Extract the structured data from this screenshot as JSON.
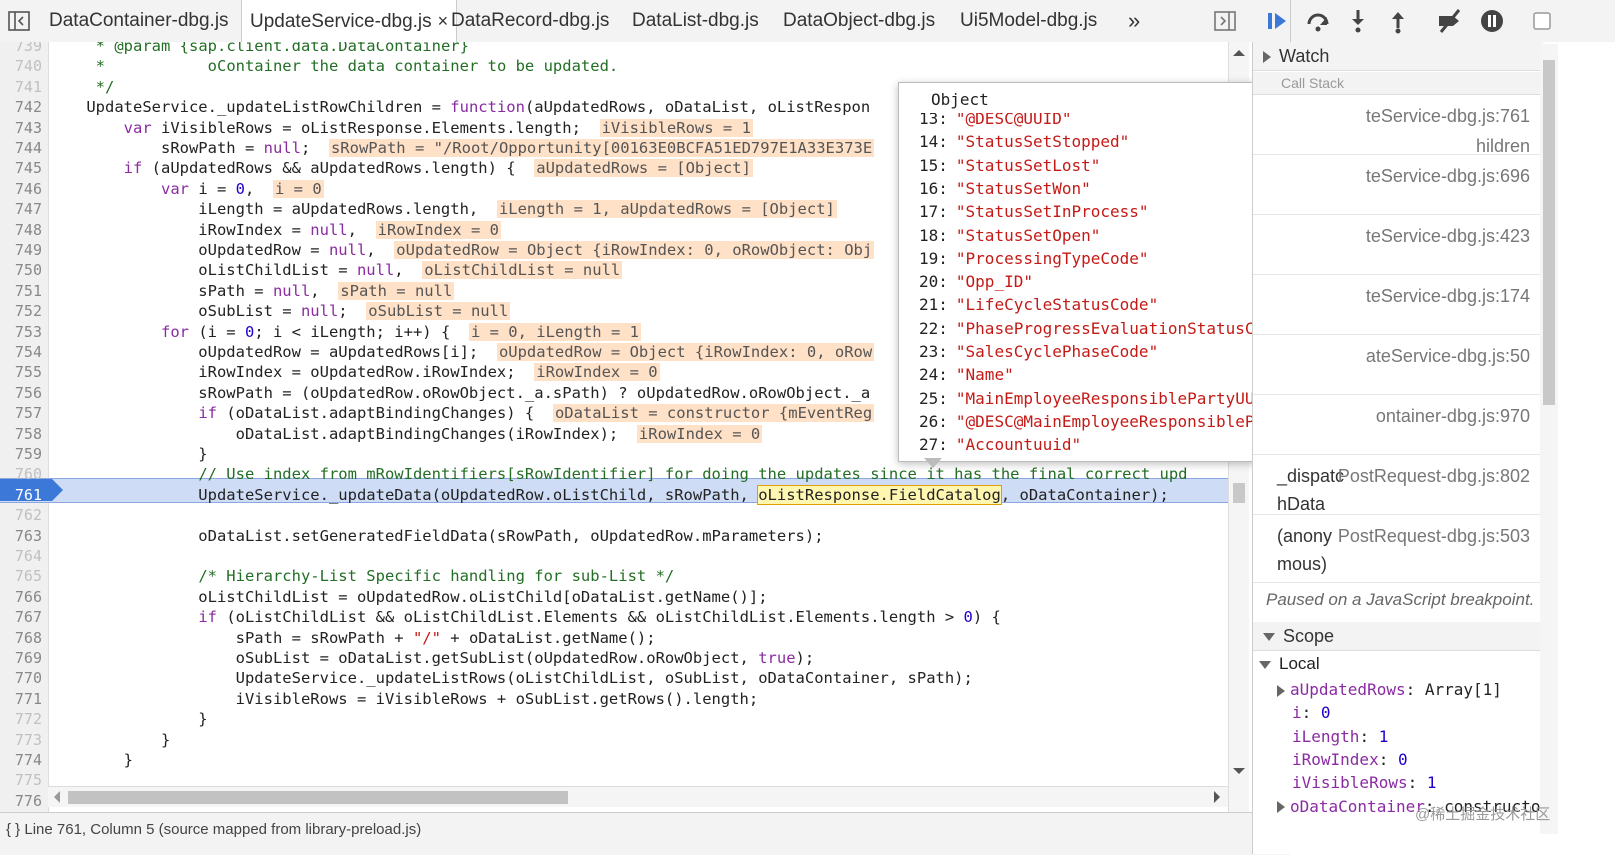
{
  "tabs": [
    {
      "label": "DataContainer-dbg.js",
      "active": false
    },
    {
      "label": "UpdateService-dbg.js",
      "active": true
    },
    {
      "label": "DataRecord-dbg.js",
      "active": false
    },
    {
      "label": "DataList-dbg.js",
      "active": false
    },
    {
      "label": "DataObject-dbg.js",
      "active": false
    },
    {
      "label": "Ui5Model-dbg.js",
      "active": false
    }
  ],
  "tabs_more": "»",
  "close_glyph": "×",
  "lines": [
    {
      "n": "739",
      "dim": true,
      "html": "     <span class=\"cm\">* @param {sap.client.data.DataContainer}</span>"
    },
    {
      "n": "740",
      "dim": true,
      "html": "     <span class=\"cm\">*           oContainer the data container to be updated.</span>"
    },
    {
      "n": "741",
      "dim": true,
      "html": "     <span class=\"cm\">*/</span>"
    },
    {
      "n": "742",
      "dim": false,
      "html": "    UpdateService._updateListRowChildren = <span class=\"fn\">function</span>(aUpdatedRows, oDataList, oListRespon"
    },
    {
      "n": "743",
      "dim": false,
      "html": "        <span class=\"kw\">var</span> iVisibleRows = oListResponse.Elements.length;  <span class=\"inl\">iVisibleRows = 1</span>"
    },
    {
      "n": "744",
      "dim": false,
      "html": "            sRowPath = <span class=\"kw\">null</span>;  <span class=\"inl\">sRowPath = \"/Root/Opportunity[00163E0BCFA51ED797E1A33E373E</span>"
    },
    {
      "n": "745",
      "dim": false,
      "html": "        <span class=\"kw\">if</span> (aUpdatedRows &amp;&amp; aUpdatedRows.length) {  <span class=\"inl\">aUpdatedRows = [Object]</span>"
    },
    {
      "n": "746",
      "dim": false,
      "html": "            <span class=\"kw\">var</span> i = <span class=\"num\">0</span>,  <span class=\"inl\">i = 0</span>"
    },
    {
      "n": "747",
      "dim": false,
      "html": "                iLength = aUpdatedRows.length,  <span class=\"inl\">iLength = 1, aUpdatedRows = [Object]</span>"
    },
    {
      "n": "748",
      "dim": false,
      "html": "                iRowIndex = <span class=\"kw\">null</span>,  <span class=\"inl\">iRowIndex = 0</span>"
    },
    {
      "n": "749",
      "dim": false,
      "html": "                oUpdatedRow = <span class=\"kw\">null</span>,  <span class=\"inl\">oUpdatedRow = Object {iRowIndex: 0, oRowObject: Obj</span>"
    },
    {
      "n": "750",
      "dim": false,
      "html": "                oListChildList = <span class=\"kw\">null</span>,  <span class=\"inl\">oListChildList = null</span>"
    },
    {
      "n": "751",
      "dim": false,
      "html": "                sPath = <span class=\"kw\">null</span>,  <span class=\"inl\">sPath = null</span>"
    },
    {
      "n": "752",
      "dim": false,
      "html": "                oSubList = <span class=\"kw\">null</span>;  <span class=\"inl\">oSubList = null</span>"
    },
    {
      "n": "753",
      "dim": false,
      "html": "            <span class=\"kw\">for</span> (i = <span class=\"num\">0</span>; i &lt; iLength; i++) {  <span class=\"inl\">i = 0, iLength = 1</span>"
    },
    {
      "n": "754",
      "dim": false,
      "html": "                oUpdatedRow = aUpdatedRows[i];  <span class=\"inl\">oUpdatedRow = Object {iRowIndex: 0, oRow</span>"
    },
    {
      "n": "755",
      "dim": false,
      "html": "                iRowIndex = oUpdatedRow.iRowIndex;  <span class=\"inl\">iRowIndex = 0</span>"
    },
    {
      "n": "756",
      "dim": false,
      "html": "                sRowPath = (oUpdatedRow.oRowObject._a.sPath) ? oUpdatedRow.oRowObject._a"
    },
    {
      "n": "757",
      "dim": false,
      "html": "                <span class=\"kw\">if</span> (oDataList.adaptBindingChanges) {  <span class=\"inl\">oDataList = constructor {mEventReg</span>"
    },
    {
      "n": "758",
      "dim": false,
      "html": "                    oDataList.adaptBindingChanges(iRowIndex);  <span class=\"inl\">iRowIndex = 0</span>"
    },
    {
      "n": "759",
      "dim": false,
      "html": "                }"
    },
    {
      "n": "760",
      "dim": true,
      "html": "                <span class=\"cm\">// Use index from mRowIdentifiers[sRowIdentifier] for doing the updates since it has the final correct upd</span>"
    },
    {
      "n": "761",
      "dim": false,
      "html": "                UpdateService._updateData(oUpdatedRow.oListChild, sRowPath, <span class=\"hovbox\">oListResponse.FieldCatalog</span>, oDataContainer);"
    },
    {
      "n": "762",
      "dim": true,
      "html": ""
    },
    {
      "n": "763",
      "dim": false,
      "html": "                oDataList.setGeneratedFieldData(sRowPath, oUpdatedRow.mParameters);"
    },
    {
      "n": "764",
      "dim": true,
      "html": ""
    },
    {
      "n": "765",
      "dim": true,
      "html": "                <span class=\"cm\">/* Hierarchy-List Specific handling for sub-List */</span>"
    },
    {
      "n": "766",
      "dim": false,
      "html": "                oListChildList = oUpdatedRow.oListChild[oDataList.getName()];"
    },
    {
      "n": "767",
      "dim": false,
      "html": "                <span class=\"kw\">if</span> (oListChildList &amp;&amp; oListChildList.Elements &amp;&amp; oListChildList.Elements.length &gt; <span class=\"num\">0</span>) {"
    },
    {
      "n": "768",
      "dim": false,
      "html": "                    sPath = sRowPath + <span class=\"str\">\"/\"</span> + oDataList.getName();"
    },
    {
      "n": "769",
      "dim": false,
      "html": "                    oSubList = oDataList.getSubList(oUpdatedRow.oRowObject, <span class=\"kw\">true</span>);"
    },
    {
      "n": "770",
      "dim": false,
      "html": "                    UpdateService._updateListRows(oListChildList, oSubList, oDataContainer, sPath);"
    },
    {
      "n": "771",
      "dim": false,
      "html": "                    iVisibleRows = iVisibleRows + oSubList.getRows().length;"
    },
    {
      "n": "772",
      "dim": true,
      "html": "                }"
    },
    {
      "n": "773",
      "dim": true,
      "html": "            }"
    },
    {
      "n": "774",
      "dim": false,
      "html": "        }"
    },
    {
      "n": "775",
      "dim": true,
      "html": ""
    },
    {
      "n": "776",
      "dim": false,
      "html": ""
    }
  ],
  "breakpoint_line": "761",
  "status_text": "{ }   Line 761, Column 5   (source mapped from library-preload.js)",
  "popover": {
    "title": "Object",
    "items": [
      {
        "idx": "13:",
        "val": "\"@DESC@UUID\""
      },
      {
        "idx": "14:",
        "val": "\"StatusSetStopped\""
      },
      {
        "idx": "15:",
        "val": "\"StatusSetLost\""
      },
      {
        "idx": "16:",
        "val": "\"StatusSetWon\""
      },
      {
        "idx": "17:",
        "val": "\"StatusSetInProcess\""
      },
      {
        "idx": "18:",
        "val": "\"StatusSetOpen\""
      },
      {
        "idx": "19:",
        "val": "\"ProcessingTypeCode\""
      },
      {
        "idx": "20:",
        "val": "\"Opp_ID\""
      },
      {
        "idx": "21:",
        "val": "\"LifeCycleStatusCode\""
      },
      {
        "idx": "22:",
        "val": "\"PhaseProgressEvaluationStatusCode\""
      },
      {
        "idx": "23:",
        "val": "\"SalesCyclePhaseCode\""
      },
      {
        "idx": "24:",
        "val": "\"Name\""
      },
      {
        "idx": "25:",
        "val": "\"MainEmployeeResponsiblePartyUUID\""
      },
      {
        "idx": "26:",
        "val": "\"@DESC@MainEmployeeResponsiblePartyUUID\""
      },
      {
        "idx": "27:",
        "val": "\"Accountuuid\""
      }
    ]
  },
  "sidebar": {
    "watch_label": "Watch",
    "call_stack_partial": "Call Stack",
    "frames": [
      {
        "name": "",
        "loc": "teService-dbg.js:761"
      },
      {
        "name": "",
        "loc": "hildren"
      },
      {
        "name": "",
        "loc": "teService-dbg.js:696"
      },
      {
        "name": "",
        "loc": "teService-dbg.js:423"
      },
      {
        "name": "",
        "loc": "teService-dbg.js:174"
      },
      {
        "name": "",
        "loc": "ateService-dbg.js:50"
      },
      {
        "name": "",
        "loc": "ontainer-dbg.js:970"
      },
      {
        "name": "_dispatc",
        "loc": "PostRequest-dbg.js:802"
      },
      {
        "name": "hData",
        "loc": ""
      },
      {
        "name": "(anony",
        "loc": "PostRequest-dbg.js:503"
      },
      {
        "name": "mous)",
        "loc": ""
      }
    ],
    "paused_text": "Paused on a JavaScript breakpoint.",
    "scope_label": "Scope",
    "local_label": "Local",
    "scope_items": [
      {
        "key": "aUpdatedRows",
        "sep": ": ",
        "val": "Array[1]",
        "expandable": true
      },
      {
        "key": "i",
        "sep": ": ",
        "val": "0",
        "expandable": false
      },
      {
        "key": "iLength",
        "sep": ": ",
        "val": "1",
        "expandable": false
      },
      {
        "key": "iRowIndex",
        "sep": ": ",
        "val": "0",
        "expandable": false
      },
      {
        "key": "iVisibleRows",
        "sep": ": ",
        "val": "1",
        "expandable": false
      },
      {
        "key": "oDataContainer",
        "sep": ": ",
        "val": "constructo",
        "expandable": true
      }
    ]
  },
  "watermark": "@稀土掘金技术社区",
  "colors": {
    "accent": "#3c78d8",
    "inline_value_bg": "#ffe1c7",
    "keyword": "#8a2ba2",
    "string": "#c41a16",
    "number": "#1c00cf"
  }
}
